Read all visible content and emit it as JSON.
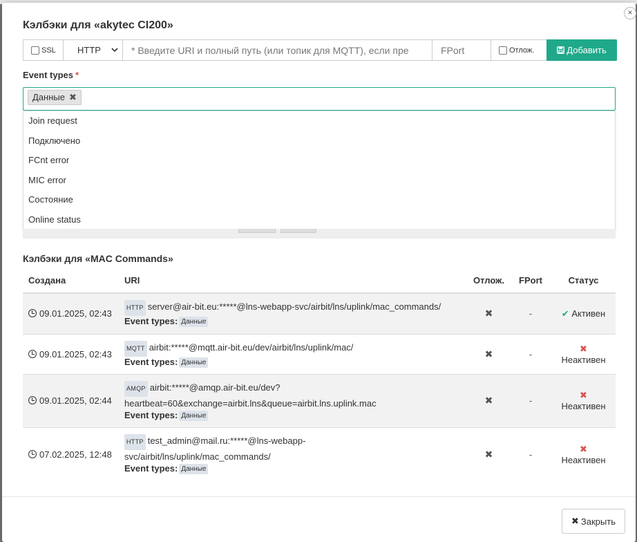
{
  "modal": {
    "title": "Кэлбэки для «akytec CI200»",
    "close_icon": "×"
  },
  "form": {
    "ssl_label": "SSL",
    "protocol_value": "HTTP",
    "uri_placeholder": "* Введите URI и полный путь (или топик для MQTT), если пре",
    "fport_placeholder": "FPort",
    "delay_label": "Отлож.",
    "add_label": "Добавить"
  },
  "event_types": {
    "label": "Event types",
    "required_mark": "*",
    "selected_tag": "Данные",
    "options": [
      "Join request",
      "Подключено",
      "FCnt error",
      "MIC error",
      "Состояние",
      "Online status"
    ]
  },
  "mac_section": {
    "title": "Кэлбэки для «MAC Commands»",
    "columns": [
      "Создана",
      "URI",
      "Отлож.",
      "FPort",
      "Статус"
    ],
    "event_types_label": "Event types:",
    "rows": [
      {
        "created": "09.01.2025, 02:43",
        "proto": "HTTP",
        "uri_line1": "server@air-bit.eu:*****@lns-webapp-svc/airbit/lns/uplink/mac_commands/",
        "uri_line2": "",
        "event": "Данные",
        "delay": "✖",
        "fport": "-",
        "status_icon": "✔",
        "status": "Активен"
      },
      {
        "created": "09.01.2025, 02:43",
        "proto": "MQTT",
        "uri_line1": "airbit:*****@mqtt.air-bit.eu/dev/airbit/lns/uplink/mac/",
        "uri_line2": "",
        "event": "Данные",
        "delay": "✖",
        "fport": "-",
        "status_icon": "✖",
        "status": "Неактивен"
      },
      {
        "created": "09.01.2025, 02:44",
        "proto": "AMQP",
        "uri_line1": "airbit:*****@amqp.air-bit.eu/dev?",
        "uri_line2": "heartbeat=60&exchange=airbit.lns&queue=airbit.lns.uplink.mac",
        "event": "Данные",
        "delay": "✖",
        "fport": "-",
        "status_icon": "✖",
        "status": "Неактивен"
      },
      {
        "created": "07.02.2025, 12:48",
        "proto": "HTTP",
        "uri_line1": "test_admin@mail.ru:*****@lns-webapp-",
        "uri_line2": "svc/airbit/lns/uplink/mac_commands/",
        "event": "Данные",
        "delay": "✖",
        "fport": "-",
        "status_icon": "✖",
        "status": "Неактивен"
      }
    ]
  },
  "footer": {
    "close_label": "Закрыть",
    "close_icon": "✖"
  }
}
